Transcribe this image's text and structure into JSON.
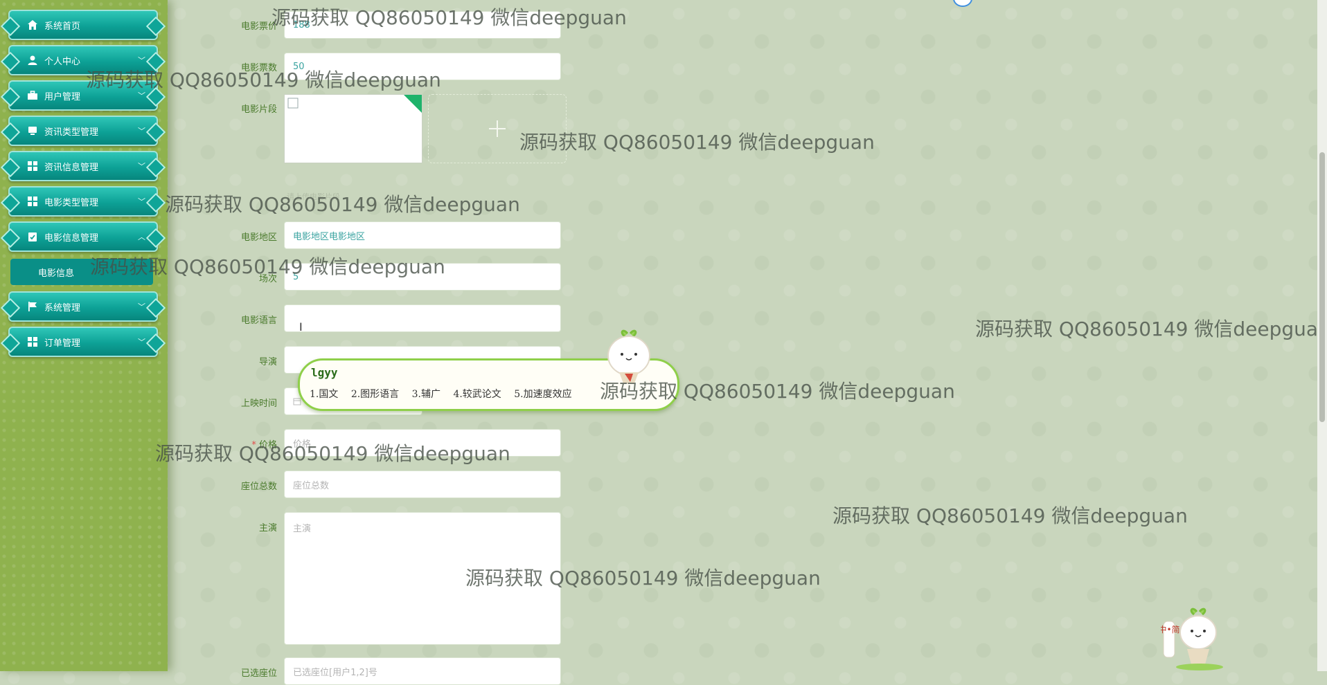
{
  "sidebar": {
    "items": [
      {
        "label": "系统首页",
        "icon": "home-icon",
        "expanded": null
      },
      {
        "label": "个人中心",
        "icon": "user-icon",
        "expanded": false
      },
      {
        "label": "用户管理",
        "icon": "briefcase-icon",
        "expanded": false
      },
      {
        "label": "资讯类型管理",
        "icon": "monitor-icon",
        "expanded": false
      },
      {
        "label": "资讯信息管理",
        "icon": "grid-icon",
        "expanded": false
      },
      {
        "label": "电影类型管理",
        "icon": "grid-icon",
        "expanded": false
      },
      {
        "label": "电影信息管理",
        "icon": "clipboard-icon",
        "expanded": true
      },
      {
        "label": "系统管理",
        "icon": "flag-icon",
        "expanded": false
      },
      {
        "label": "订单管理",
        "icon": "grid-icon",
        "expanded": false
      }
    ],
    "submenu": {
      "label": "电影信息"
    }
  },
  "form": {
    "ticket_price": {
      "label": "电影票价",
      "value": "188"
    },
    "ticket_count": {
      "label": "电影票数",
      "value": "50"
    },
    "clip": {
      "label": "电影片段",
      "upload_icon": "plus-icon"
    },
    "hint": {
      "text": "请上传电影片段"
    },
    "region": {
      "label": "电影地区",
      "value": "电影地区电影地区"
    },
    "sessions": {
      "label": "场次",
      "value": "5"
    },
    "language": {
      "label": "电影语言",
      "value": ""
    },
    "director": {
      "label": "导演",
      "value": ""
    },
    "release_time": {
      "label": "上映时间",
      "value": ""
    },
    "price": {
      "label": "价格",
      "placeholder": "价格"
    },
    "seats": {
      "label": "座位总数",
      "placeholder": "座位总数"
    },
    "cast": {
      "label": "主演",
      "placeholder": "主演"
    },
    "seat_selected": {
      "label": "已选座位",
      "placeholder": "已选座位[用户1,2]号"
    }
  },
  "ime": {
    "input": "lgyy",
    "candidates": [
      "1.国文",
      "2.图形语言",
      "3.辅广",
      "4.较武论文",
      "5.加速度效应"
    ],
    "mascot_badge": "中•简"
  },
  "watermark": "源码获取 QQ86050149 微信deepguan",
  "colors": {
    "accent": "#0da196",
    "label": "#4a7a2c",
    "sidebar_bg": "#8fb24e",
    "value": "#3aa3a0"
  }
}
